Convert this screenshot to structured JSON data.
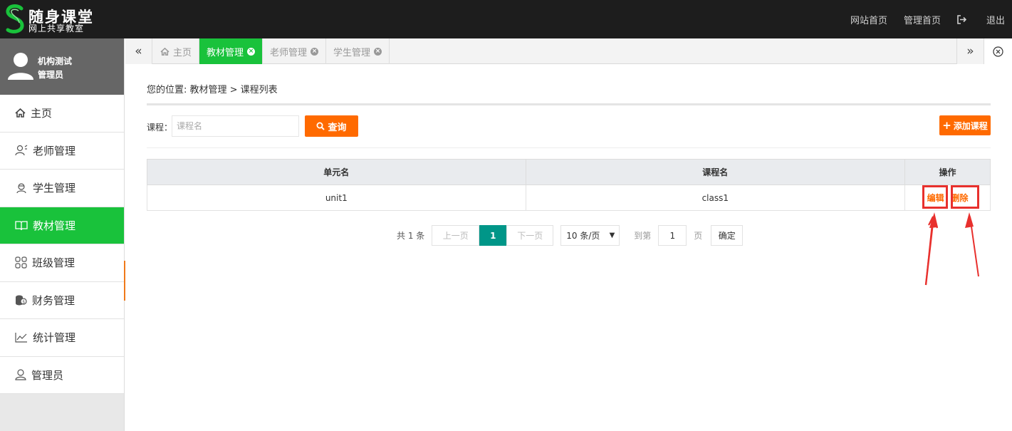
{
  "header": {
    "logo_title": "随身课堂",
    "logo_subtitle": "网上共享教室",
    "nav": {
      "site_home": "网站首页",
      "admin_home": "管理首页",
      "logout": "退出"
    }
  },
  "sidebar": {
    "user_name": "机构测试",
    "user_role": "管理员",
    "items": [
      {
        "label": "主页",
        "icon": "home-icon"
      },
      {
        "label": "老师管理",
        "icon": "teacher-icon"
      },
      {
        "label": "学生管理",
        "icon": "student-icon"
      },
      {
        "label": "教材管理",
        "icon": "book-icon",
        "active": true
      },
      {
        "label": "班级管理",
        "icon": "grid-icon"
      },
      {
        "label": "财务管理",
        "icon": "money-icon"
      },
      {
        "label": "统计管理",
        "icon": "chart-icon"
      },
      {
        "label": "管理员",
        "icon": "user-icon"
      }
    ]
  },
  "tabs": [
    {
      "label": "主页"
    },
    {
      "label": "教材管理",
      "active": true
    },
    {
      "label": "老师管理"
    },
    {
      "label": "学生管理"
    }
  ],
  "main": {
    "breadcrumb": "您的位置: 教材管理 > 课程列表",
    "search_label": "课程：",
    "search_placeholder": "课程名",
    "query_button": "查询",
    "add_button": "添加课程",
    "table": {
      "headers": [
        "单元名",
        "课程名",
        "操作"
      ],
      "rows": [
        {
          "unit": "unit1",
          "course": "class1",
          "edit": "编辑",
          "delete": "删除"
        }
      ]
    },
    "pager": {
      "total": "共 1 条",
      "prev": "上一页",
      "current": "1",
      "next": "下一页",
      "page_size": "10 条/页",
      "goto_label": "到第",
      "goto_value": "1",
      "page_unit": "页",
      "confirm": "确定"
    }
  },
  "colors": {
    "accent_green": "#19c23b",
    "accent_orange": "#ff6a00",
    "pager_teal": "#009688",
    "annotation_red": "#e8302d"
  }
}
